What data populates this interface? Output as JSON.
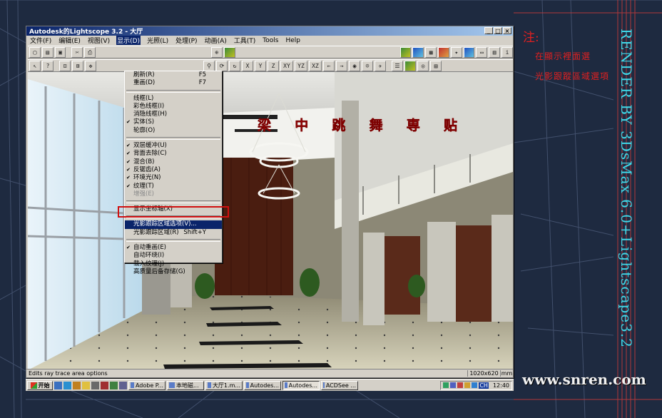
{
  "window": {
    "title": "Autodesk的Lightscope 3.2 - 大厅",
    "min": "_",
    "max": "□",
    "close": "×"
  },
  "menubar": {
    "items": [
      "文件(F)",
      "编辑(E)",
      "视图(V)",
      "显示(D)",
      "光照(L)",
      "处理(P)",
      "动画(A)",
      "工具(T)",
      "Tools",
      "Help"
    ],
    "active_index": 3
  },
  "display_menu": {
    "items": [
      {
        "label": "刷新(R)",
        "shortcut": "F5"
      },
      {
        "label": "重画(D)",
        "shortcut": "F7"
      },
      {
        "sep": true
      },
      {
        "label": "线框(L)"
      },
      {
        "label": "彩色线框(I)"
      },
      {
        "label": "消隐线框(H)"
      },
      {
        "label": "实体(S)",
        "checked": true
      },
      {
        "label": "轮廓(O)"
      },
      {
        "sep": true
      },
      {
        "label": "双层缓冲(U)",
        "checked": true
      },
      {
        "label": "背面去除(C)",
        "checked": true
      },
      {
        "label": "混合(B)",
        "checked": true
      },
      {
        "label": "反锯齿(A)",
        "checked": true
      },
      {
        "label": "环境光(N)",
        "checked": true
      },
      {
        "label": "纹理(T)",
        "checked": true
      },
      {
        "label": "增强(E)",
        "disabled": true
      },
      {
        "sep": true
      },
      {
        "label": "显示坐标轴(X)"
      },
      {
        "sep": true
      },
      {
        "label": "光影跟踪区域选项(V)...",
        "highlight": true
      },
      {
        "label": "光影跟踪区域(R)",
        "shortcut": "Shift+Y"
      },
      {
        "sep": true
      },
      {
        "label": "自动重画(E)",
        "checked": true
      },
      {
        "label": "自动环绕(I)"
      },
      {
        "label": "载入纹理(J)"
      },
      {
        "label": "高质量后备存储(G)"
      }
    ]
  },
  "banner": {
    "chars": [
      "梁",
      "中",
      "跳",
      "舞",
      "専",
      "贴"
    ]
  },
  "toolbar": {
    "axis_buttons": [
      "X",
      "Y",
      "Z",
      "XY",
      "YZ",
      "XZ"
    ]
  },
  "statusbar": {
    "message": "Edits ray trace area options",
    "resolution": "1020x620",
    "unit": "mm"
  },
  "taskbar": {
    "start": "开始",
    "tasks": [
      "Adobe P...",
      "本地磁...",
      "大厅1.m...",
      "Autodes...",
      "Autodes...",
      "ACDSee ..."
    ],
    "pressed_index": 4,
    "lang": "CH",
    "clock": "12:40"
  },
  "annotations": {
    "title": "注:",
    "line1": "在顯示裡面選",
    "line2": "光影跟蹤區域選項",
    "vertical": "RENDER BY 3DsMax 6.0+Lightscape3.2",
    "watermark": "www.snren.com"
  },
  "colors": {
    "accent_red": "#e02020",
    "menu_highlight": "#0a246a",
    "vertical_text": "#3fd8e8"
  }
}
